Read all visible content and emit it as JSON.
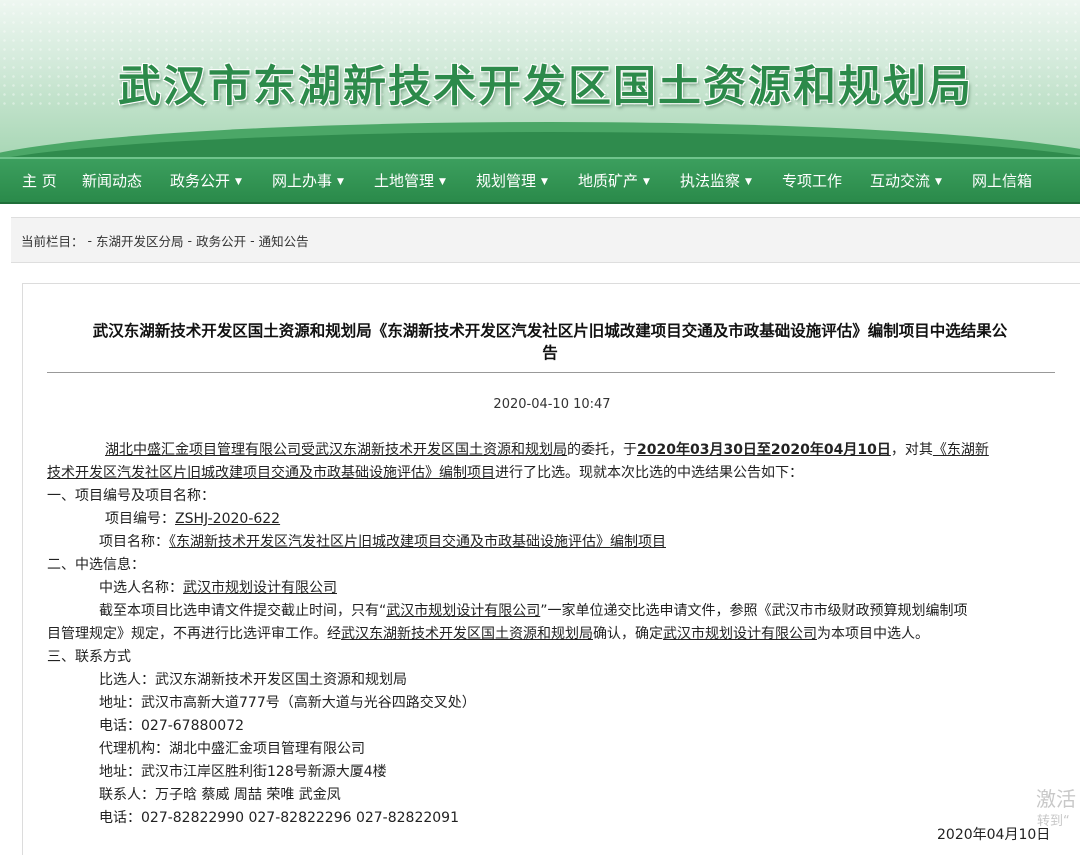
{
  "header": {
    "site_title": "武汉市东湖新技术开发区国土资源和规划局"
  },
  "nav": {
    "items": [
      {
        "label": "主 页",
        "has_caret": false
      },
      {
        "label": "新闻动态",
        "has_caret": false
      },
      {
        "label": "政务公开",
        "has_caret": true
      },
      {
        "label": "网上办事",
        "has_caret": true
      },
      {
        "label": "土地管理",
        "has_caret": true
      },
      {
        "label": "规划管理",
        "has_caret": true
      },
      {
        "label": "地质矿产",
        "has_caret": true
      },
      {
        "label": "执法监察",
        "has_caret": true
      },
      {
        "label": "专项工作",
        "has_caret": false
      },
      {
        "label": "互动交流",
        "has_caret": true
      },
      {
        "label": "网上信箱",
        "has_caret": false
      }
    ]
  },
  "breadcrumb": {
    "prefix": "当前栏目：",
    "items": [
      "东湖开发区分局",
      "政务公开",
      "通知公告"
    ],
    "sep": "-"
  },
  "article": {
    "title_line1": "武汉东湖新技术开发区国土资源和规划局《东湖新技术开发区汽发社区片旧城改建项目交通及市政基础设施评估》编制项目中选结果公",
    "title_line2": "告",
    "date": "2020-04-10 10:47",
    "p1": {
      "a": "湖北中盛汇金项目管理有限公司受武汉东湖新技术开发区国土资源和规划局",
      "b": "的委托，于",
      "c": "2020年03月30日至2020年04月10日",
      "d": "，对其",
      "e": "《东湖新",
      "f": "技术开发区汽发社区片旧城改建项目交通及市政基础设施评估》编制项目",
      "g": "进行了比选。现就本次比选的中选结果公告如下："
    },
    "s1": "一、项目编号及项目名称：",
    "proj_no_label": "项目编号：",
    "proj_no": "ZSHJ-2020-622",
    "proj_name_label": "项目名称：",
    "proj_name": "《东湖新技术开发区汽发社区片旧城改建项目交通及市政基础设施评估》编制项目",
    "s2": "二、中选信息：",
    "winner_label": "中选人名称：",
    "winner": "武汉市规划设计有限公司",
    "p2": {
      "a": "截至本项目比选申请文件提交截止时间，只有“",
      "b": "武汉市规划设计有限公司",
      "c": "”一家单位递交比选申请文件，参照《武汉市市级财政预算规划编制项",
      "d": "目管理规定》规定，不再进行比选评审工作。经",
      "e": "武汉东湖新技术开发区国土资源和规划局",
      "f": "确认，确定",
      "g": "武汉市规划设计有限公司",
      "h": "为本项目中选人。"
    },
    "s3": "三、联系方式",
    "contacts": [
      "比选人：武汉东湖新技术开发区国土资源和规划局",
      "地址：武汉市高新大道777号（高新大道与光谷四路交叉处）",
      "电话：027-67880072",
      "代理机构：湖北中盛汇金项目管理有限公司",
      "地址：武汉市江岸区胜利街128号新源大厦4楼",
      "联系人：万子晗  蔡威  周喆  荣唯  武金凤",
      "电话：027-82822990  027-82822296  027-82822091"
    ],
    "sign_date": "2020年04月10日"
  },
  "watermark": {
    "line1": "激活",
    "line2": "转到“"
  }
}
